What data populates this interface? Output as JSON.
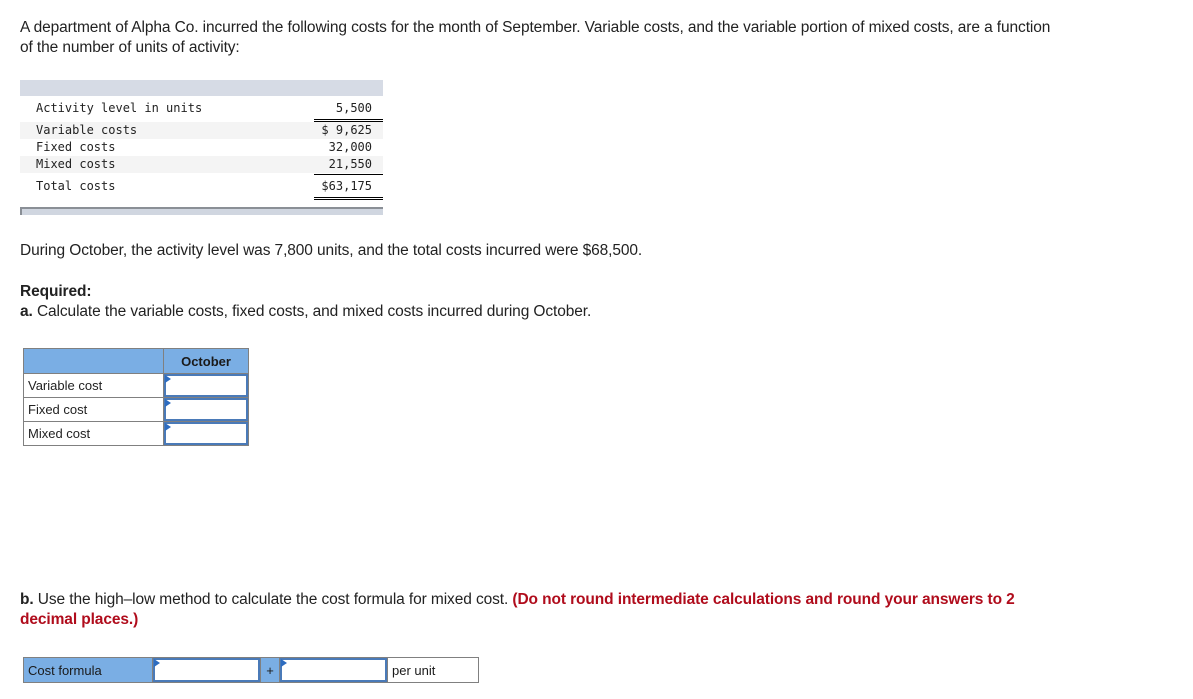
{
  "intro": "A department of Alpha Co. incurred the following costs for the month of September. Variable costs, and the variable portion of mixed costs, are a function of the number of units of activity:",
  "september_table": {
    "rows": [
      {
        "label": "Activity level in units",
        "value": "5,500"
      },
      {
        "label": "Variable costs",
        "value": "$ 9,625"
      },
      {
        "label": "Fixed costs",
        "value": "32,000"
      },
      {
        "label": "Mixed costs",
        "value": "21,550"
      },
      {
        "label": "Total costs",
        "value": "$63,175"
      }
    ]
  },
  "october_text": "During October, the activity level was 7,800 units, and the total costs incurred were $68,500.",
  "required_heading": "Required:",
  "part_a": {
    "prefix": "a.",
    "text": " Calculate the variable costs, fixed costs, and mixed costs incurred during October.",
    "column_header": "October",
    "rows": [
      {
        "label": "Variable cost",
        "value": ""
      },
      {
        "label": "Fixed cost",
        "value": ""
      },
      {
        "label": "Mixed cost",
        "value": ""
      }
    ]
  },
  "part_b": {
    "prefix": "b.",
    "text": " Use the high–low method to calculate the cost formula for mixed cost. ",
    "instruction": "(Do not round intermediate calculations and round your answers to 2 decimal places.)",
    "formula_label": "Cost formula",
    "fixed_value": "",
    "plus_sign": "+",
    "variable_value": "",
    "unit_label": "per unit"
  },
  "colors": {
    "header_blue": "#7aaee4",
    "instruction_red": "#b00c1c",
    "input_border": "#4a7ab8"
  }
}
